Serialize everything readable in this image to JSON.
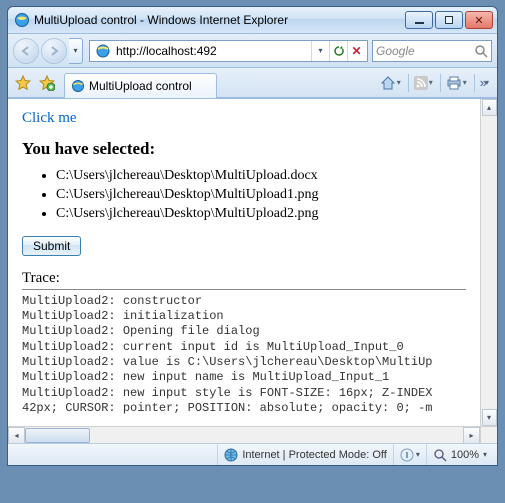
{
  "window": {
    "title": "MultiUpload control - Windows Internet Explorer"
  },
  "nav": {
    "url": "http://localhost:492",
    "search_placeholder": "Google"
  },
  "tab": {
    "label": "MultiUpload control"
  },
  "page": {
    "link_text": "Click me",
    "heading": "You have selected:",
    "files": [
      "C:\\Users\\jlchereau\\Desktop\\MultiUpload.docx",
      "C:\\Users\\jlchereau\\Desktop\\MultiUpload1.png",
      "C:\\Users\\jlchereau\\Desktop\\MultiUpload2.png"
    ],
    "submit_label": "Submit",
    "trace_label": "Trace:",
    "trace_lines": [
      "MultiUpload2: constructor",
      "MultiUpload2: initialization",
      "MultiUpload2: Opening file dialog",
      "MultiUpload2: current input id is MultiUpload_Input_0",
      "MultiUpload2: value is C:\\Users\\jlchereau\\Desktop\\MultiUp",
      "MultiUpload2: new input name is MultiUpload_Input_1",
      "MultiUpload2: new input style is FONT-SIZE: 16px; Z-INDEX",
      "42px; CURSOR: pointer; POSITION: absolute; opacity: 0; -m"
    ]
  },
  "status": {
    "zone": "Internet | Protected Mode: Off",
    "zoom": "100%"
  },
  "icons": {
    "dd": "▾",
    "x": "✕"
  }
}
